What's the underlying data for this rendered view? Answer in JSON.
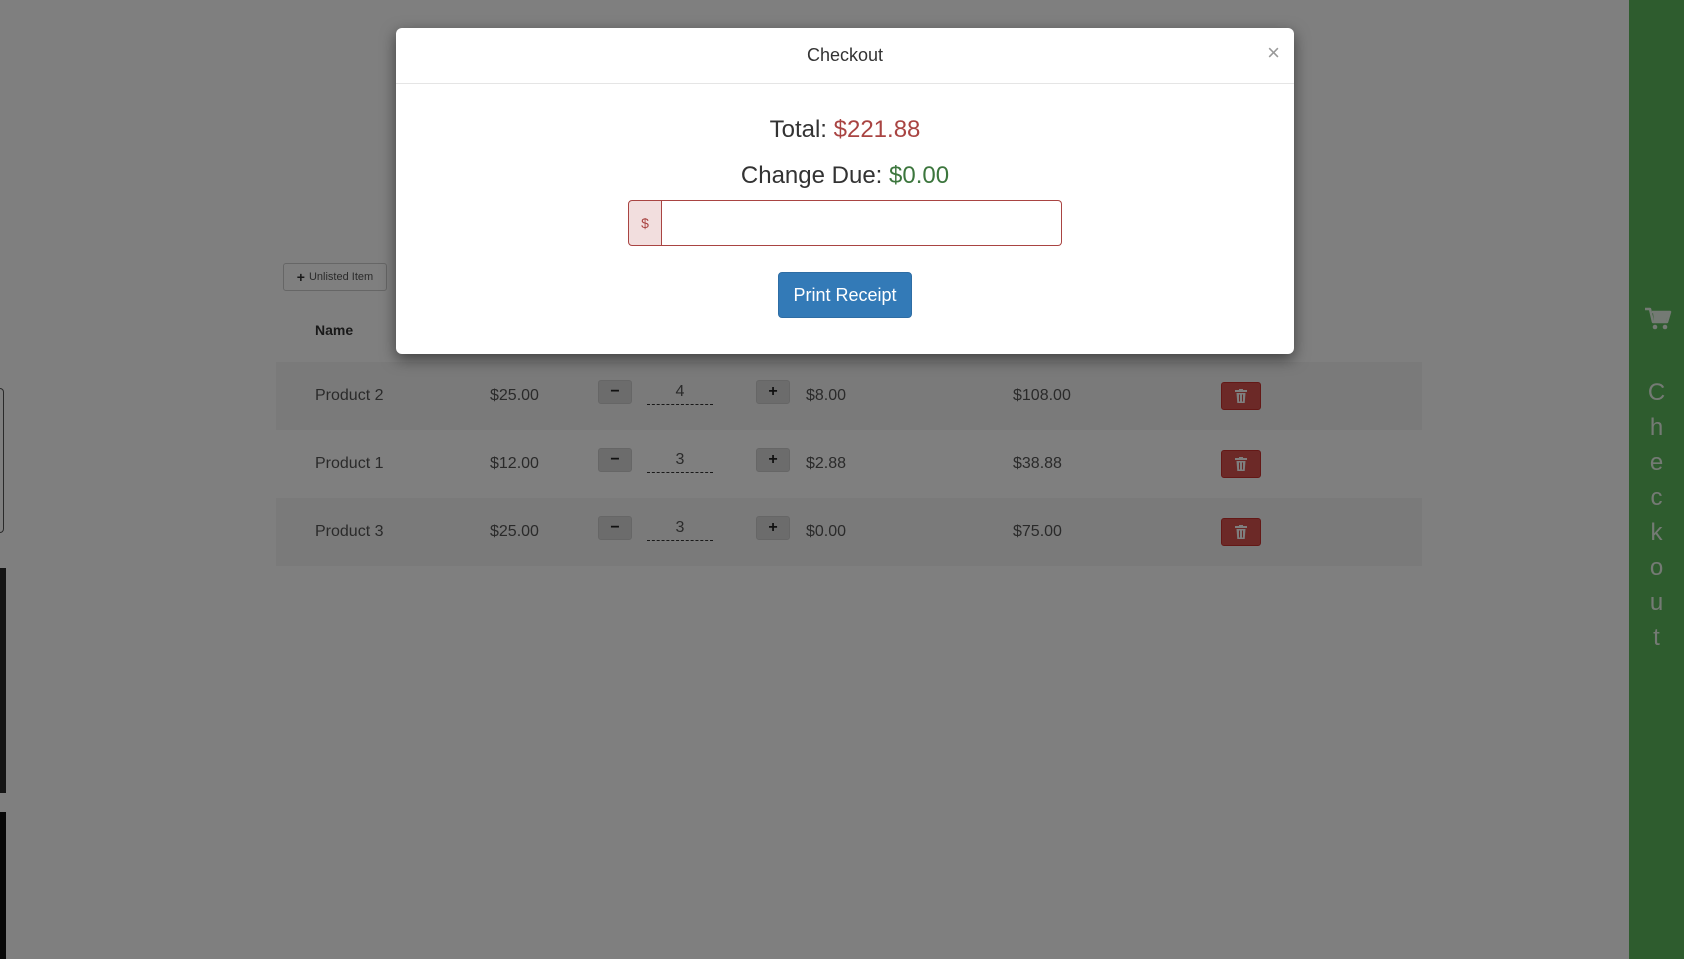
{
  "toolbar": {
    "unlisted_label": "Unlisted Item"
  },
  "table": {
    "name_header": "Name",
    "rows": [
      {
        "name": "Product 2",
        "price": "$25.00",
        "qty": "4",
        "tax": "$8.00",
        "total": "$108.00"
      },
      {
        "name": "Product 1",
        "price": "$12.00",
        "qty": "3",
        "tax": "$2.88",
        "total": "$38.88"
      },
      {
        "name": "Product 3",
        "price": "$25.00",
        "qty": "3",
        "tax": "$0.00",
        "total": "$75.00"
      }
    ],
    "minus_label": "−",
    "plus_label": "+"
  },
  "sidebar": {
    "letters": [
      "C",
      "h",
      "e",
      "c",
      "k",
      "o",
      "u",
      "t"
    ],
    "icon": "cart-icon",
    "color": "#5cb85c"
  },
  "modal": {
    "title": "Checkout",
    "close_label": "×",
    "total_label": "Total:",
    "total_value": "$221.88",
    "change_label": "Change Due:",
    "change_value": "$0.00",
    "currency_addon": "$",
    "payment_value": "",
    "print_label": "Print Receipt"
  },
  "colors": {
    "primary": "#337ab7",
    "danger": "#d9534f",
    "success": "#3c763d",
    "error_text": "#a94442"
  }
}
